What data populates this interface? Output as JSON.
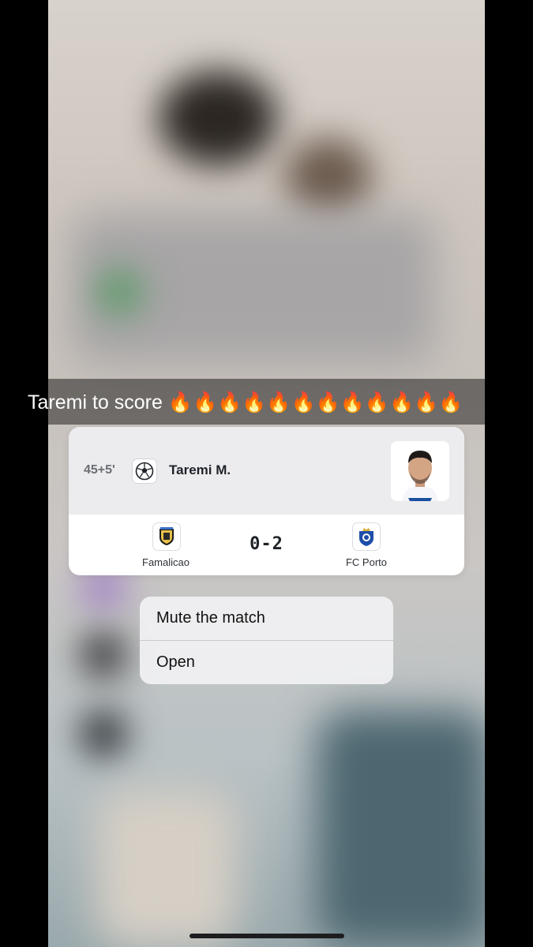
{
  "caption": {
    "text": "Taremi to score 🔥🔥🔥🔥🔥🔥🔥🔥🔥🔥🔥🔥"
  },
  "notification": {
    "minute": "45+5'",
    "event_icon": "soccer-ball-icon",
    "scorer": "Taremi M.",
    "home_team": "Famalicao",
    "away_team": "FC Porto",
    "score": "0-2"
  },
  "menu": {
    "items": [
      {
        "label": "Mute the match"
      },
      {
        "label": "Open"
      }
    ]
  },
  "colors": {
    "card_top": "#ececee",
    "card_bottom": "#ffffff",
    "menu_bg": "#f0f0f2"
  }
}
